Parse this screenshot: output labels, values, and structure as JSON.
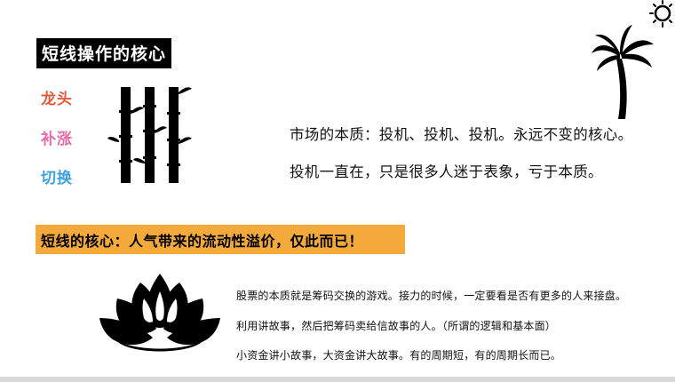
{
  "title": "短线操作的核心",
  "keywords": [
    {
      "label": "龙头",
      "color": "#e05a3a"
    },
    {
      "label": "补涨",
      "color": "#e86aa6"
    },
    {
      "label": "切换",
      "color": "#3aa0e0"
    }
  ],
  "statements": [
    "市场的本质：投机、投机、投机。永远不变的核心。",
    "投机一直在，只是很多人迷于表象，亏于本质。"
  ],
  "banner": {
    "text": "短线的核心：人气带来的流动性溢价，仅此而已！",
    "color": "#f4a93b"
  },
  "notes": [
    "股票的本质就是筹码交换的游戏。接力的时候，一定要看是否有更多的人来接盘。",
    "利用讲故事，然后把筹码卖给信故事的人。（所谓的逻辑和基本面）",
    "小资金讲小故事，大资金讲大故事。有的周期短，有的周期长而已。"
  ],
  "icons": [
    "bamboo-icon",
    "palm-tree-icon",
    "sun-icon",
    "lotus-icon"
  ]
}
